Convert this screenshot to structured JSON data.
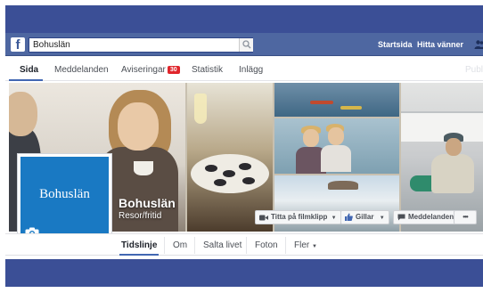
{
  "fb_bar": {
    "search_value": "Bohuslän",
    "links": [
      "Startsida",
      "Hitta vänner"
    ]
  },
  "page_tabs": [
    {
      "label": "Sida"
    },
    {
      "label": "Meddelanden"
    },
    {
      "label": "Aviseringar",
      "badge": "30"
    },
    {
      "label": "Statistik"
    },
    {
      "label": "Inlägg"
    }
  ],
  "page_tabs_faded": "Publ",
  "profile": {
    "logo_text": "Bohuslän",
    "name": "Bohuslän",
    "category": "Resor/fritid"
  },
  "actions": {
    "watch_video": "Titta på filmklipp",
    "like": "Gillar",
    "message": "Meddelanden",
    "more": "•••"
  },
  "timeline_tabs": [
    "Tidslinje",
    "Om",
    "Salta livet",
    "Foton",
    "Fler"
  ],
  "colors": {
    "fb_blue": "#4e67a1",
    "frame_blue": "#3b4f96",
    "profile_blue": "#1979c3",
    "badge_red": "#e0252b"
  }
}
